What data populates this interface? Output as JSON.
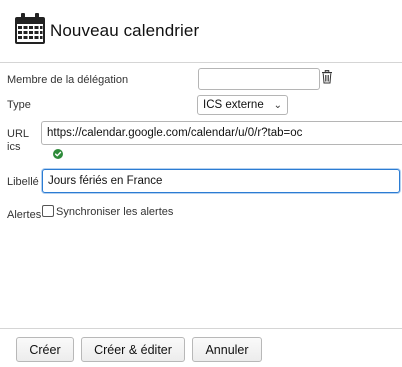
{
  "dialog": {
    "title": "Nouveau calendrier",
    "icon": "calendar-icon"
  },
  "form": {
    "delegation": {
      "label": "Membre de la délégation",
      "value": "",
      "icon": "trash-icon"
    },
    "type": {
      "label": "Type",
      "selected": "ICS externe"
    },
    "url": {
      "label_line1": "URL",
      "label_line2": "ics",
      "value": "https://calendar.google.com/calendar/u/0/r?tab=oc",
      "status_icon": "check-circle-icon",
      "status_color": "#2e8b3a"
    },
    "libelle": {
      "label": "Libellé",
      "value": "Jours fériés en France"
    },
    "alertes": {
      "label": "Alertes",
      "checkbox_label": "Synchroniser les alertes",
      "checked": false
    }
  },
  "actions": {
    "create": "Créer",
    "create_edit": "Créer & éditer",
    "cancel": "Annuler"
  },
  "colors": {
    "focus": "#2b7cd3",
    "border": "#b5b5b5"
  }
}
